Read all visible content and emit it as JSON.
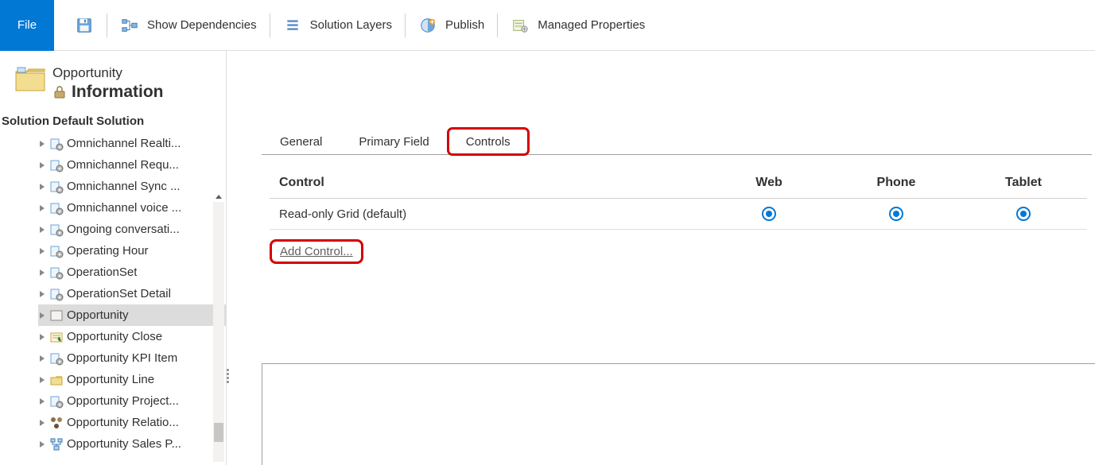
{
  "toolbar": {
    "file": "File",
    "show_dependencies": "Show Dependencies",
    "solution_layers": "Solution Layers",
    "publish": "Publish",
    "managed_properties": "Managed Properties"
  },
  "entity": {
    "name": "Opportunity",
    "form": "Information"
  },
  "solution": {
    "prefix": "Solution",
    "name": "Default Solution",
    "items": [
      {
        "label": "Omnichannel Realti...",
        "icon": "gear"
      },
      {
        "label": "Omnichannel Requ...",
        "icon": "gear"
      },
      {
        "label": "Omnichannel Sync ...",
        "icon": "gear"
      },
      {
        "label": "Omnichannel voice ...",
        "icon": "gear"
      },
      {
        "label": "Ongoing conversati...",
        "icon": "gear"
      },
      {
        "label": "Operating Hour",
        "icon": "gear"
      },
      {
        "label": "OperationSet",
        "icon": "gear"
      },
      {
        "label": "OperationSet Detail",
        "icon": "gear"
      },
      {
        "label": "Opportunity",
        "icon": "entity",
        "selected": true
      },
      {
        "label": "Opportunity Close",
        "icon": "activity"
      },
      {
        "label": "Opportunity KPI Item",
        "icon": "gear"
      },
      {
        "label": "Opportunity Line",
        "icon": "folder"
      },
      {
        "label": "Opportunity Project...",
        "icon": "gear"
      },
      {
        "label": "Opportunity Relatio...",
        "icon": "relation"
      },
      {
        "label": "Opportunity Sales P...",
        "icon": "process"
      }
    ]
  },
  "tabs": [
    {
      "label": "General",
      "active": false
    },
    {
      "label": "Primary Field",
      "active": false
    },
    {
      "label": "Controls",
      "active": true,
      "highlight": true
    }
  ],
  "grid": {
    "columns": [
      "Control",
      "Web",
      "Phone",
      "Tablet"
    ],
    "row": {
      "name": "Read-only Grid (default)",
      "web": true,
      "phone": true,
      "tablet": true
    }
  },
  "add_control": "Add Control..."
}
